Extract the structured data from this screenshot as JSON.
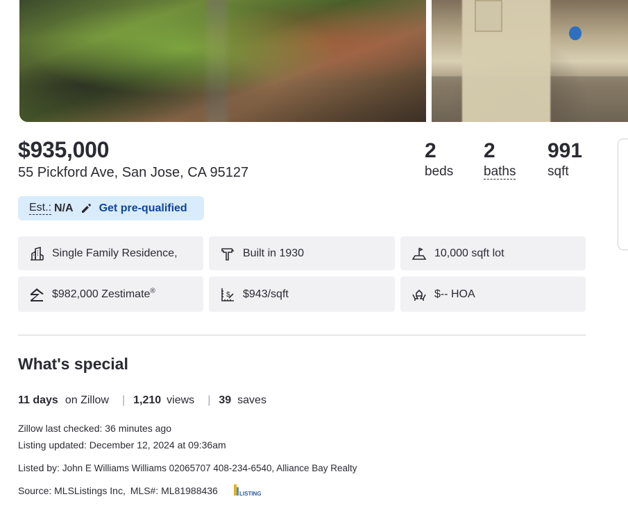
{
  "photos": [
    {
      "alt": "Garden path with plants"
    },
    {
      "alt": "Backyard shed"
    }
  ],
  "listing": {
    "price": "$935,000",
    "address": "55 Pickford Ave, San Jose, CA 95127"
  },
  "stats": {
    "beds_num": "2",
    "beds_label": "beds",
    "baths_num": "2",
    "baths_label": "baths",
    "sqft_num": "991",
    "sqft_label": "sqft"
  },
  "estimate": {
    "label": "Est.:",
    "value": "N/A",
    "prequal_link": "Get pre-qualified"
  },
  "facts": {
    "type": "Single Family Residence,",
    "built": "Built in 1930",
    "lot": "10,000 sqft lot",
    "zestimate": "$982,000 Zestimate",
    "zestimate_mark": "®",
    "price_per_sqft": "$943/sqft",
    "hoa": "$-- HOA"
  },
  "special": {
    "title": "What's special",
    "days_num": "11 days",
    "days_text": "on Zillow",
    "views_num": "1,210",
    "views_text": "views",
    "saves_num": "39",
    "saves_text": "saves",
    "separator": "|"
  },
  "meta": {
    "checked": "Zillow last checked: 36 minutes ago",
    "updated": "Listing updated: December 12, 2024 at 09:36am",
    "listed_by_label": "Listed by:",
    "listed_by_value": "John E Williams Williams 02065707 408-234-6540, Alliance Bay Realty",
    "source": "Source: MLSListings Inc,",
    "mls": "MLS#: ML81988436"
  },
  "logo_text": "LISTINGS",
  "colors": {
    "link_blue": "#0d4599",
    "pill_bg": "#d9ecfc",
    "fact_bg": "#f1f1f4",
    "text": "#2a2a33"
  }
}
